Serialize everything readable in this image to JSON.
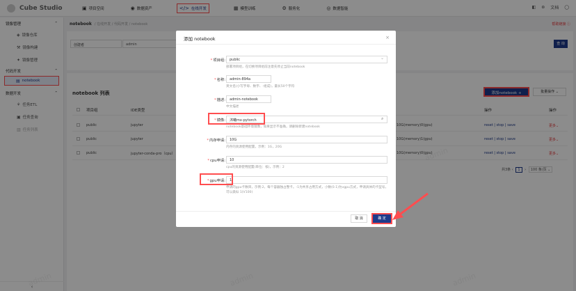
{
  "app": {
    "title": "Cube Studio"
  },
  "topnav": [
    {
      "icon": "▣",
      "label": "项目空间"
    },
    {
      "icon": "◉",
      "label": "数据资产"
    },
    {
      "icon": "</>",
      "label": "在线开发"
    },
    {
      "icon": "▦",
      "label": "模型训练"
    },
    {
      "icon": "⚙",
      "label": "服务化"
    },
    {
      "icon": "◎",
      "label": "数据智能"
    }
  ],
  "topright": {
    "icon1": "◧",
    "icon2": "⊛",
    "docs": "文档",
    "user_icon": "◯"
  },
  "sidebar": {
    "group_image": "镜像管理",
    "items_image": [
      "镜像仓库",
      "镜像构建",
      "镜像管理"
    ],
    "group_code": "代码开发",
    "item_notebook": "notebook",
    "group_data": "数据开发",
    "items_data": [
      "任务ETL",
      "任务查询",
      "任务列表"
    ],
    "collapse": "‹"
  },
  "breadcrumb": {
    "title": "notebook",
    "path": "/ 在线开发 / 代码开发 / notebook"
  },
  "help_link": "帮助链接 ⓘ",
  "filter": {
    "creator_label": "创建者",
    "creator_value": "admin",
    "query_btn": "查 询"
  },
  "list": {
    "title": "notebook 列表",
    "add_btn": "添加notebook +",
    "batch_btn": "批量操作 ⌄",
    "headers": [
      "项目组",
      "IDE类型",
      "操作",
      "操作"
    ],
    "rows": [
      {
        "project": "public",
        "ide": "jupyter",
        "res": "10G(memory)0(gpu)",
        "ops": "reset | stop | save",
        "more": "更多⌄"
      },
      {
        "project": "public",
        "ide": "jupyter",
        "res": "10G(memory)1(gpu)",
        "ops": "reset | stop | save",
        "more": "更多⌄"
      },
      {
        "project": "public",
        "ide": "jupyter-conda-pro（cpu）",
        "res": "10G(memory)0(gpu)",
        "ops": "reset | stop | save",
        "more": "更多⌄"
      }
    ],
    "pager": {
      "total": "共3条",
      "page": "1",
      "size": "100 条/页 ⌄"
    }
  },
  "modal": {
    "title": "添加 notebook",
    "close": "×",
    "fields": {
      "project": {
        "label": "项目组:",
        "value": "public",
        "help": "部署项目组，在切换项目组前注意先停止当前notebook"
      },
      "name": {
        "label": "名称:",
        "value": "admin-894a",
        "help": "英文名(小写字母、数字、-组成)，最长50个字符"
      },
      "desc": {
        "label": "描述:",
        "value": "admin-notebook",
        "help": "中文描述"
      },
      "image": {
        "label": "镜像:",
        "value": "沐曦mx-pytorch",
        "help": "notebook基础环境镜像，如果显示不准确，请删除新建notebook"
      },
      "memory": {
        "label": "内存申请:",
        "value": "10G",
        "help": "内存的资源使用配置，示例：1G，20G"
      },
      "cpu": {
        "label": "cpu申请:",
        "value": "10",
        "help": "cpu的资源使用配置(单位：核)，示例：2"
      },
      "gpu": {
        "label": "gpu申请:",
        "value": "1",
        "help": "申请的gpu卡数目，示例:2，每个容器独占整卡。-1为共享占用方式，小数(0.1)为vgpu方式，申请具体的卡型号，可以类似 1(V100)"
      }
    },
    "cancel": "取 消",
    "ok": "确 定"
  },
  "watermark": "admin"
}
